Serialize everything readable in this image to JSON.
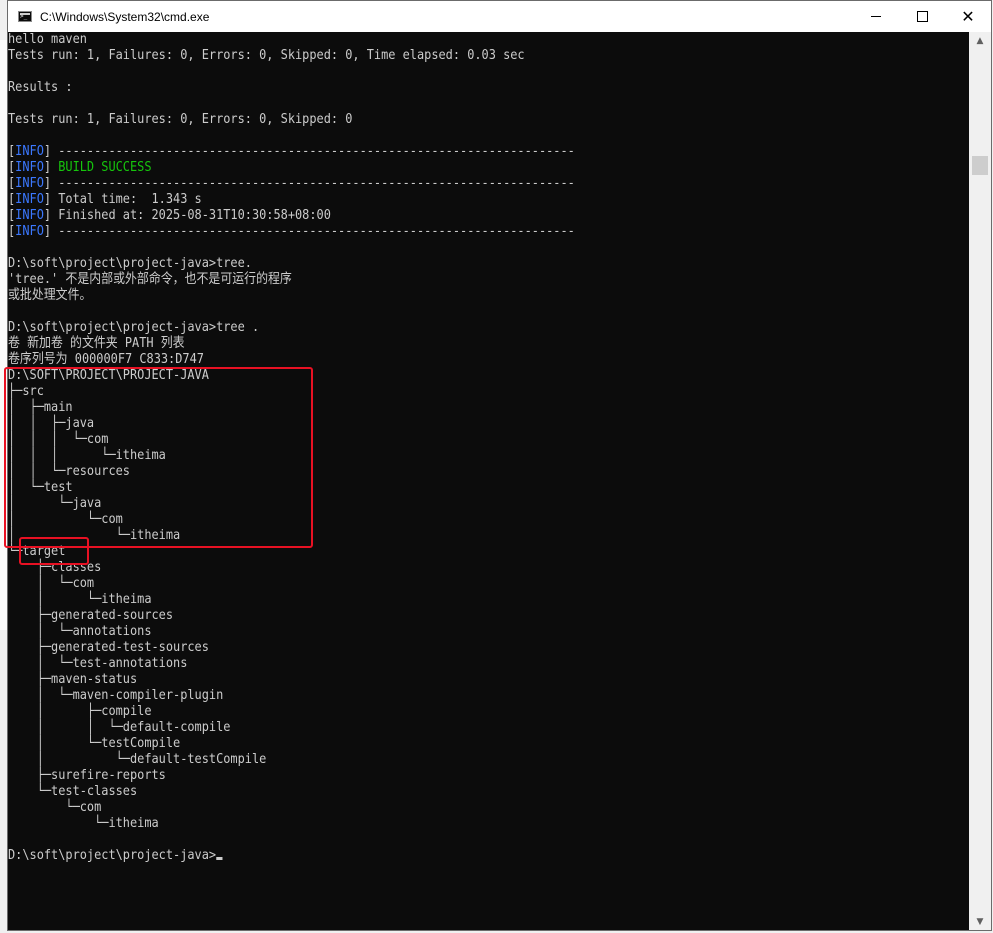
{
  "window": {
    "title": "C:\\Windows\\System32\\cmd.exe",
    "controls": {
      "minimize": "",
      "maximize": "",
      "close": "✕"
    }
  },
  "console": {
    "lines": [
      "hello maven",
      "Tests run: 1, Failures: 0, Errors: 0, Skipped: 0, Time elapsed: 0.03 sec",
      "",
      "Results :",
      "",
      "Tests run: 1, Failures: 0, Errors: 0, Skipped: 0",
      "",
      "[INFO] ------------------------------------------------------------------------",
      "[INFO] BUILD SUCCESS",
      "[INFO] ------------------------------------------------------------------------",
      "[INFO] Total time:  1.343 s",
      "[INFO] Finished at: 2025-08-31T10:30:58+08:00",
      "[INFO] ------------------------------------------------------------------------",
      "",
      "D:\\soft\\project\\project-java>tree.",
      "'tree.' 不是内部或外部命令，也不是可运行的程序",
      "或批处理文件。",
      "",
      "D:\\soft\\project\\project-java>tree .",
      "卷 新加卷 的文件夹 PATH 列表",
      "卷序列号为 000000F7 C833:D747",
      "D:\\SOFT\\PROJECT\\PROJECT-JAVA",
      "├─src",
      "│  ├─main",
      "│  │  ├─java",
      "│  │  │  └─com",
      "│  │  │      └─itheima",
      "│  │  └─resources",
      "│  └─test",
      "│      └─java",
      "│          └─com",
      "│              └─itheima",
      "└─target",
      "    ├─classes",
      "    │  └─com",
      "    │      └─itheima",
      "    ├─generated-sources",
      "    │  └─annotations",
      "    ├─generated-test-sources",
      "    │  └─test-annotations",
      "    ├─maven-status",
      "    │  └─maven-compiler-plugin",
      "    │      ├─compile",
      "    │      │  └─default-compile",
      "    │      └─testCompile",
      "    │          └─default-testCompile",
      "    ├─surefire-reports",
      "    └─test-classes",
      "        └─com",
      "            └─itheima",
      "",
      "D:\\soft\\project\\project-java>"
    ]
  },
  "colors": {
    "info_tag": "#3b78ff",
    "build_success": "#16c60c",
    "highlight_border": "#e81123",
    "console_bg": "#0c0c0c",
    "console_fg": "#cccccc"
  },
  "scrollbar": {
    "up": "▲",
    "down": "▼"
  }
}
